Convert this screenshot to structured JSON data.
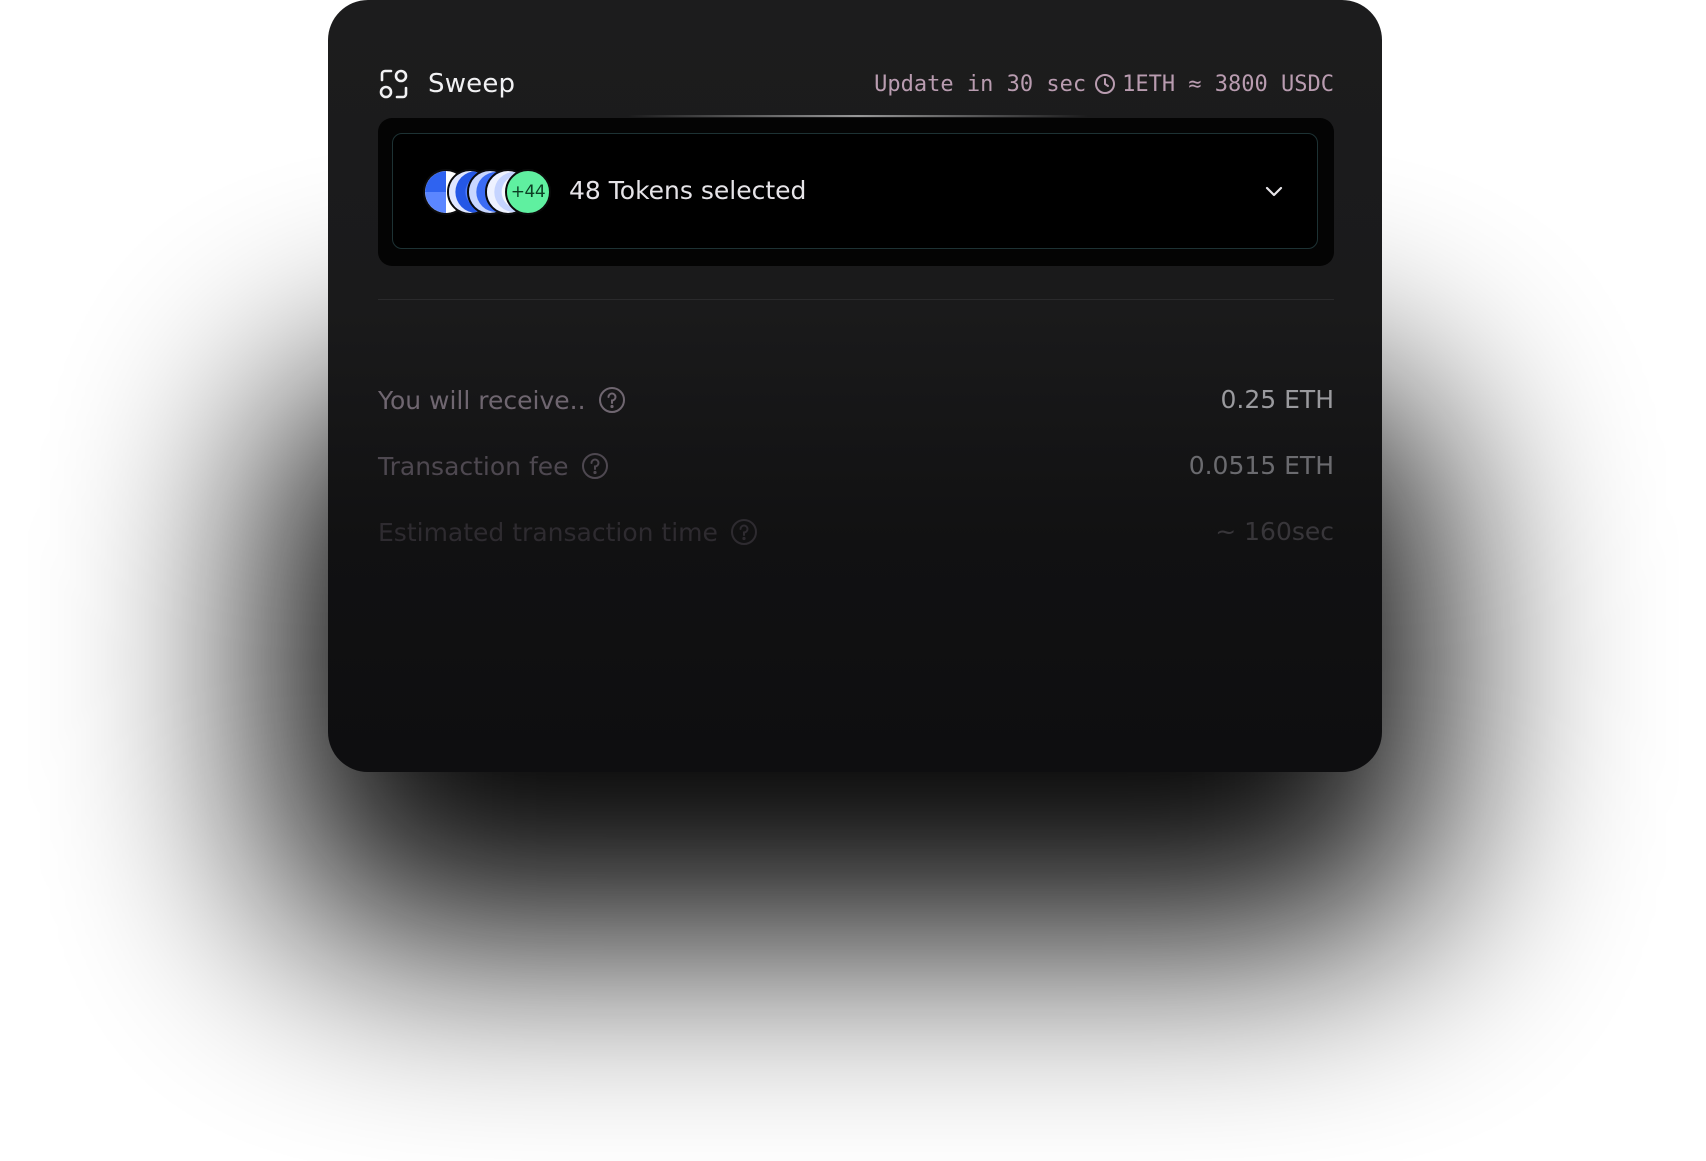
{
  "app": {
    "name": "Sweep",
    "icon": "sweep-logo-icon"
  },
  "rate": {
    "update_text": "Update in 30 sec",
    "clock_icon": "clock-icon",
    "conversion": "1ETH ≈ 3800 USDC"
  },
  "token_selector": {
    "label": "48 Tokens selected",
    "more_count": "+44",
    "token_icons": [
      "token-icon",
      "token-icon",
      "token-icon",
      "token-icon"
    ],
    "chevron_icon": "chevron-down-icon",
    "accent_color": "#5ff0a0"
  },
  "summary": {
    "rows": [
      {
        "label": "You will receive..",
        "value": "0.25 ETH",
        "icon": "help-icon"
      },
      {
        "label": "Transaction fee",
        "value": "0.0515 ETH",
        "icon": "help-icon"
      },
      {
        "label": "Estimated transaction time",
        "value": "~ 160sec",
        "icon": "help-icon"
      }
    ]
  },
  "colors": {
    "card_background": "#1c1c1d",
    "rate_text": "#b99cb0",
    "token_blue": "#2f63f0"
  }
}
